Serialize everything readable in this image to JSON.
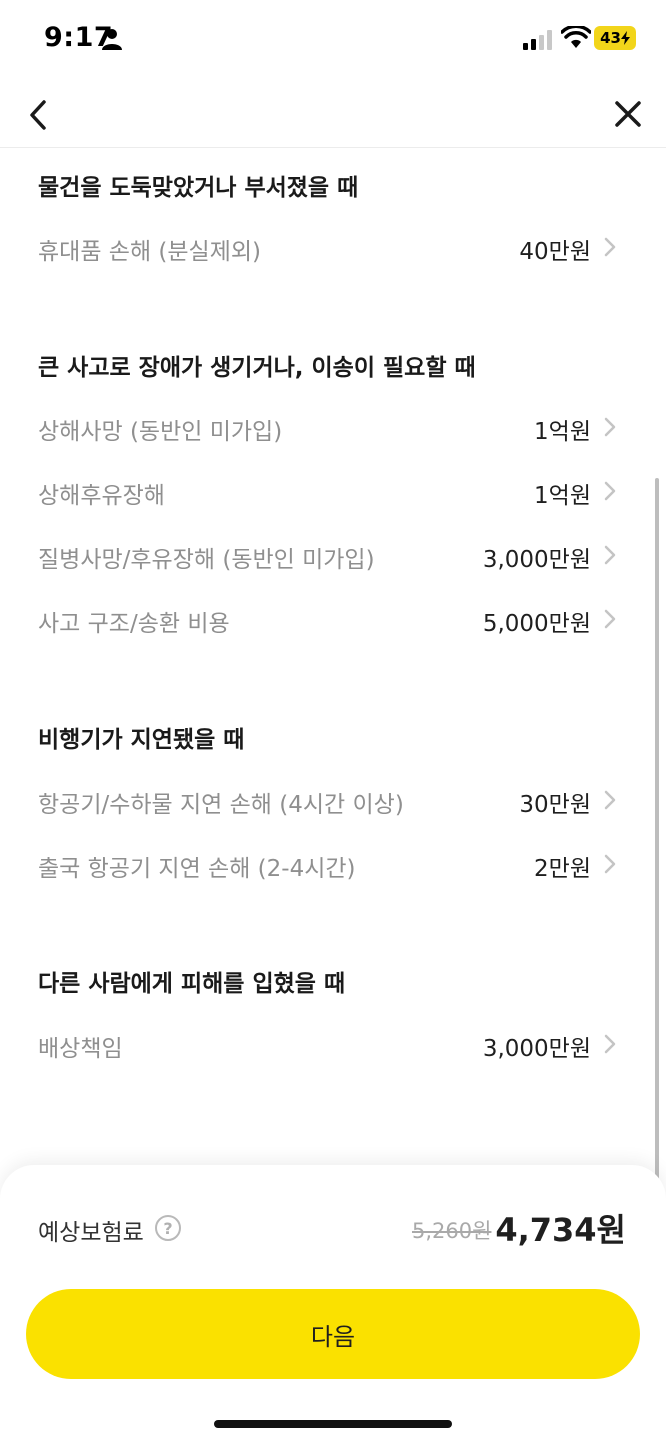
{
  "status_bar": {
    "time": "9:17",
    "battery": "43"
  },
  "sections": [
    {
      "title": "물건을 도둑맞았거나 부서졌을 때",
      "rows": [
        {
          "label": "휴대품 손해 (분실제외)",
          "value": "40만원"
        }
      ]
    },
    {
      "title": "큰 사고로 장애가 생기거나, 이송이 필요할 때",
      "rows": [
        {
          "label": "상해사망 (동반인 미가입)",
          "value": "1억원"
        },
        {
          "label": "상해후유장해",
          "value": "1억원"
        },
        {
          "label": "질병사망/후유장해 (동반인 미가입)",
          "value": "3,000만원"
        },
        {
          "label": "사고 구조/송환 비용",
          "value": "5,000만원"
        }
      ]
    },
    {
      "title": "비행기가 지연됐을 때",
      "rows": [
        {
          "label": "항공기/수하물 지연 손해 (4시간 이상)",
          "value": "30만원"
        },
        {
          "label": "출국 항공기 지연 손해 (2-4시간)",
          "value": "2만원"
        }
      ]
    },
    {
      "title": "다른 사람에게 피해를 입혔을 때",
      "rows": [
        {
          "label": "배상책임",
          "value": "3,000만원"
        }
      ]
    }
  ],
  "footer": {
    "premium_label": "예상보험료",
    "help_symbol": "?",
    "old_price": "5,260원",
    "new_price": "4,734원",
    "next_label": "다음"
  },
  "colors": {
    "accent": "#fae100",
    "battery": "#f2d51a",
    "muted_text": "#8f8f8f"
  },
  "icons": [
    "person-icon",
    "signal-icon",
    "wifi-icon",
    "back-icon",
    "close-icon",
    "chevron-right-icon",
    "help-icon"
  ]
}
